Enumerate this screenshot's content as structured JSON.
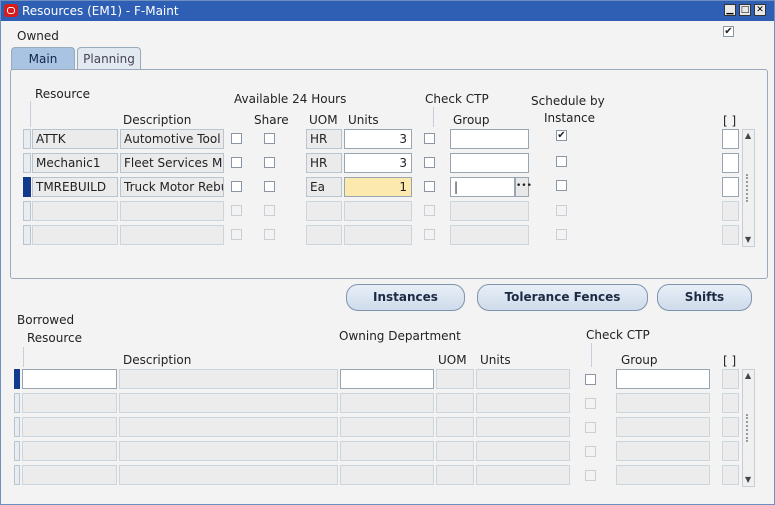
{
  "window": {
    "title": "Resources (EM1) - F-Maint"
  },
  "owned": {
    "label": "Owned",
    "checked": true
  },
  "tabs": [
    {
      "label": "Main",
      "active": true
    },
    {
      "label": "Planning",
      "active": false
    }
  ],
  "main_headers": {
    "resource": "Resource",
    "description": "Description",
    "available24": "Available 24 Hours",
    "share": "Share",
    "uom": "UOM",
    "units": "Units",
    "check_ctp": "Check CTP",
    "group": "Group",
    "schedule_by_1": "Schedule by",
    "schedule_by_2": "Instance",
    "more": "[ ]"
  },
  "resources": [
    {
      "resource": "ATTK",
      "description": "Automotive Tool K",
      "uom": "HR",
      "units": "3",
      "schedule_by_instance": true
    },
    {
      "resource": "Mechanic1",
      "description": "Fleet Services Me",
      "uom": "HR",
      "units": "3",
      "schedule_by_instance": false
    },
    {
      "resource": "TMREBUILD",
      "description": "Truck Motor Rebu",
      "uom": "Ea",
      "units": "1",
      "schedule_by_instance": false
    }
  ],
  "buttons": {
    "instances": "Instances",
    "tolerance_fences": "Tolerance Fences",
    "shifts": "Shifts"
  },
  "borrowed": {
    "label": "Borrowed",
    "headers": {
      "resource": "Resource",
      "description": "Description",
      "owning_department": "Owning Department",
      "uom": "UOM",
      "units": "Units",
      "check_ctp": "Check CTP",
      "group": "Group",
      "more": "[ ]"
    }
  },
  "icons": {
    "lov": "ellipsis-icon",
    "title_app": "oracle-icon"
  }
}
